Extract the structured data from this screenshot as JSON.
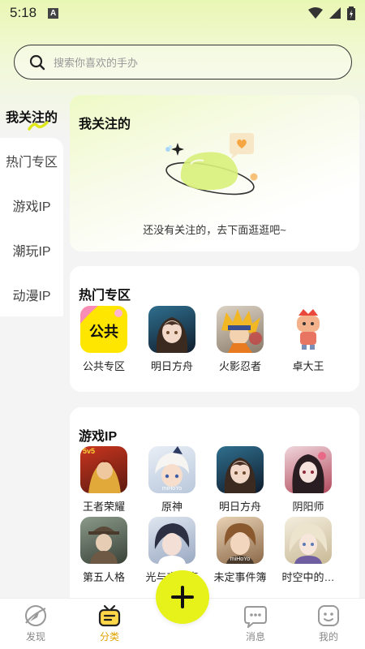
{
  "status": {
    "time": "5:18",
    "notif_badge": "A"
  },
  "search": {
    "placeholder": "搜索你喜欢的手办"
  },
  "sidebar": {
    "items": [
      {
        "label": "我关注的"
      },
      {
        "label": "热门专区"
      },
      {
        "label": "游戏IP"
      },
      {
        "label": "潮玩IP"
      },
      {
        "label": "动漫IP"
      }
    ]
  },
  "follow": {
    "title": "我关注的",
    "empty_text": "还没有关注的，去下面逛逛吧~"
  },
  "hot": {
    "title": "热门专区",
    "items": [
      {
        "label": "公共专区",
        "icon_text": "公共"
      },
      {
        "label": "明日方舟"
      },
      {
        "label": "火影忍者"
      },
      {
        "label": "卓大王"
      }
    ]
  },
  "game": {
    "title": "游戏IP",
    "items": [
      {
        "label": "王者荣耀",
        "icon_text": "5v5"
      },
      {
        "label": "原神",
        "icon_text": "miHoYo"
      },
      {
        "label": "明日方舟"
      },
      {
        "label": "阴阳师"
      },
      {
        "label": "第五人格"
      },
      {
        "label": "光与夜之恋"
      },
      {
        "label": "未定事件簿",
        "icon_text": "miHoYo"
      },
      {
        "label": "时空中的…"
      }
    ]
  },
  "nav": {
    "items": [
      {
        "label": "发现"
      },
      {
        "label": "分类"
      },
      {
        "label": "消息"
      },
      {
        "label": "我的"
      }
    ]
  },
  "colors": {
    "accent": "#e6f21a",
    "active_nav": "#e0a200"
  }
}
